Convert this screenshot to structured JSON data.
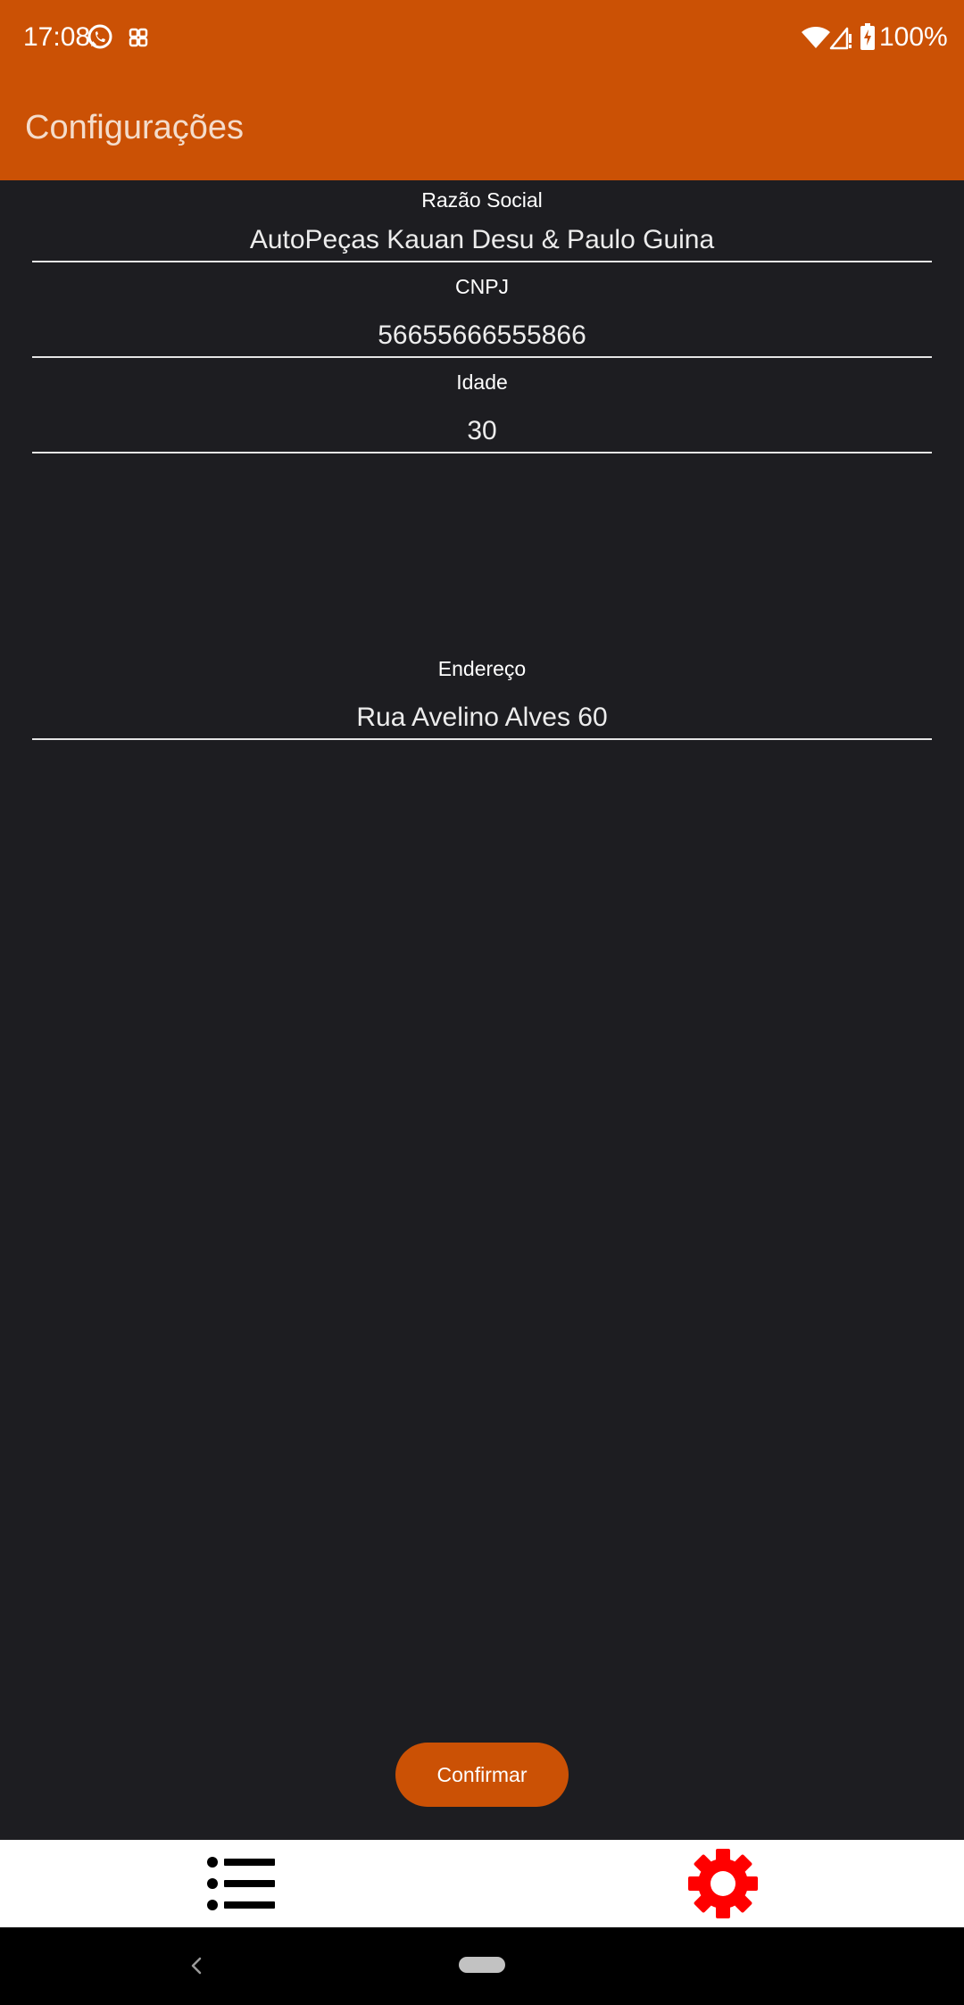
{
  "status_bar": {
    "time": "17:08",
    "battery": "100%",
    "icons": [
      "whatsapp-icon",
      "notification-icon",
      "wifi-icon",
      "signal-icon",
      "battery-charging-icon"
    ]
  },
  "app_bar": {
    "title": "Configurações"
  },
  "form": {
    "razao_social": {
      "label": "Razão Social",
      "value": "AutoPeças Kauan Desu & Paulo Guina"
    },
    "cnpj": {
      "label": "CNPJ",
      "value": "56655666555866"
    },
    "idade": {
      "label": "Idade",
      "value": "30"
    },
    "endereco": {
      "label": "Endereço",
      "value": "Rua Avelino Alves 60"
    }
  },
  "actions": {
    "confirm_label": "Confirmar"
  },
  "bottom_nav": {
    "items": [
      {
        "icon": "list-icon",
        "selected": false
      },
      {
        "icon": "gear-icon",
        "selected": true
      }
    ]
  },
  "colors": {
    "accent": "#cb5105",
    "background": "#1d1d21",
    "selected_nav": "#ff0000",
    "unselected_nav": "#000000"
  }
}
